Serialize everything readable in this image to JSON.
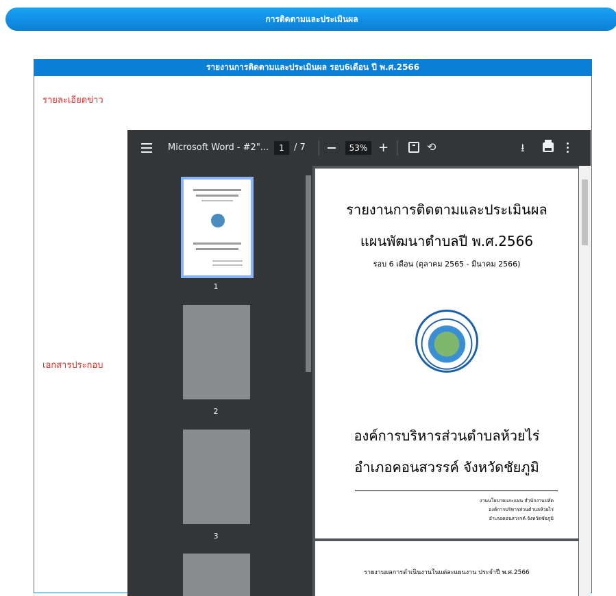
{
  "banner": {
    "title": "การติดตามและประเมินผล"
  },
  "panel": {
    "header": "รายงานการติดตามและประเมินผล รอบ6เดือน ปี พ.ศ.2566",
    "detail_label": "รายละเอียดข่าว",
    "attachment_label": "เอกสารประกอบ"
  },
  "viewer": {
    "doc_title": "Microsoft Word - #2\"...",
    "current_page": "1",
    "page_total": "/ 7",
    "zoom": "53%",
    "zoom_in_label": "+",
    "icons": [
      "menu-icon",
      "zoom-out-icon",
      "zoom-in-icon",
      "fit-page-icon",
      "rotate-icon",
      "download-icon",
      "print-icon",
      "more-options-icon"
    ],
    "thumbnails": [
      {
        "number": "1"
      },
      {
        "number": "2"
      },
      {
        "number": "3"
      }
    ],
    "page1": {
      "title_line1": "รายงานการติดตามและประเมินผล",
      "title_line2": "แผนพัฒนาตำบลปี พ.ศ.2566",
      "subtitle": "รอบ 6 เดือน (ตุลาคม 2565 - มีนาคม 2566)",
      "org_line1": "องค์การบริหารส่วนตำบลห้วยไร่",
      "org_line2": "อำเภอคอนสวรรค์  จังหวัดชัยภูมิ",
      "footer_line1": "งานนโยบายและแผน สำนักงานปลัด",
      "footer_line2": "องค์การบริหารส่วนตำบลห้วยไร่",
      "footer_line3": "อำเภอคอนสวรรค์ จังหวัดชัยภูมิ"
    },
    "page2": {
      "title_line1": "รายงานผลการดำเนินงานในแต่ละแผนงาน ประจำปี พ.ศ.2566"
    }
  },
  "colors": {
    "accent": "#0a7fd6",
    "label": "#d9302a",
    "viewer_bg": "#525659",
    "toolbar_bg": "#323639"
  }
}
